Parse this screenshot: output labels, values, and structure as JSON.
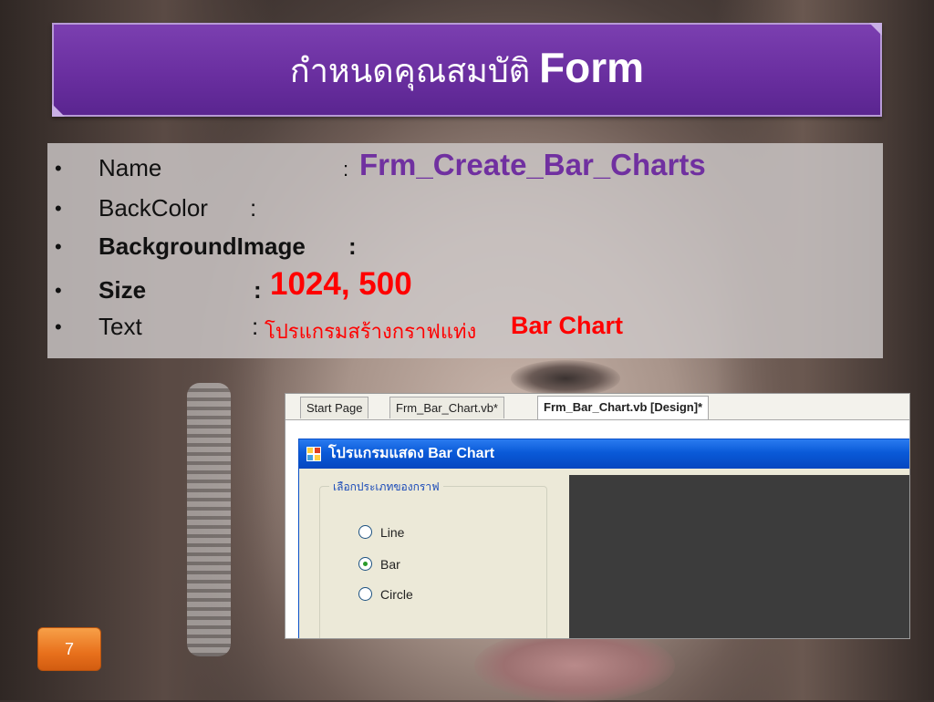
{
  "slide": {
    "title_thai": "กำหนดคุณสมบัติ",
    "title_en": "Form",
    "page_number": "7"
  },
  "properties": [
    {
      "label": "Name",
      "colon": ":",
      "value": "Frm_Create_Bar_Charts"
    },
    {
      "label": "BackColor",
      "colon": ":",
      "value": ""
    },
    {
      "label": "BackgroundImage",
      "colon": ":",
      "value": ""
    },
    {
      "label": "Size",
      "colon": ":",
      "value": "1024, 500"
    },
    {
      "label": "Text",
      "colon": ":",
      "value_thai": "โปรแกรมสร้างกราฟแท่ง",
      "value_en": "Bar Chart"
    }
  ],
  "ide": {
    "tabs": [
      "Start Page",
      "Frm_Bar_Chart.vb*",
      "Frm_Bar_Chart.vb [Design]*"
    ],
    "active_tab": 2,
    "form_title": "โปรแกรมแสดง Bar Chart",
    "group_title": "เลือกประเภทของกราฟ",
    "radio_options": [
      {
        "label": "Line",
        "checked": false
      },
      {
        "label": "Bar",
        "checked": true
      },
      {
        "label": "Circle",
        "checked": false
      }
    ]
  },
  "colors": {
    "title_bar": "#6a2fa0",
    "name_value": "#7030a0",
    "highlight_red": "#ff0000",
    "page_badge": "#e8701c"
  }
}
